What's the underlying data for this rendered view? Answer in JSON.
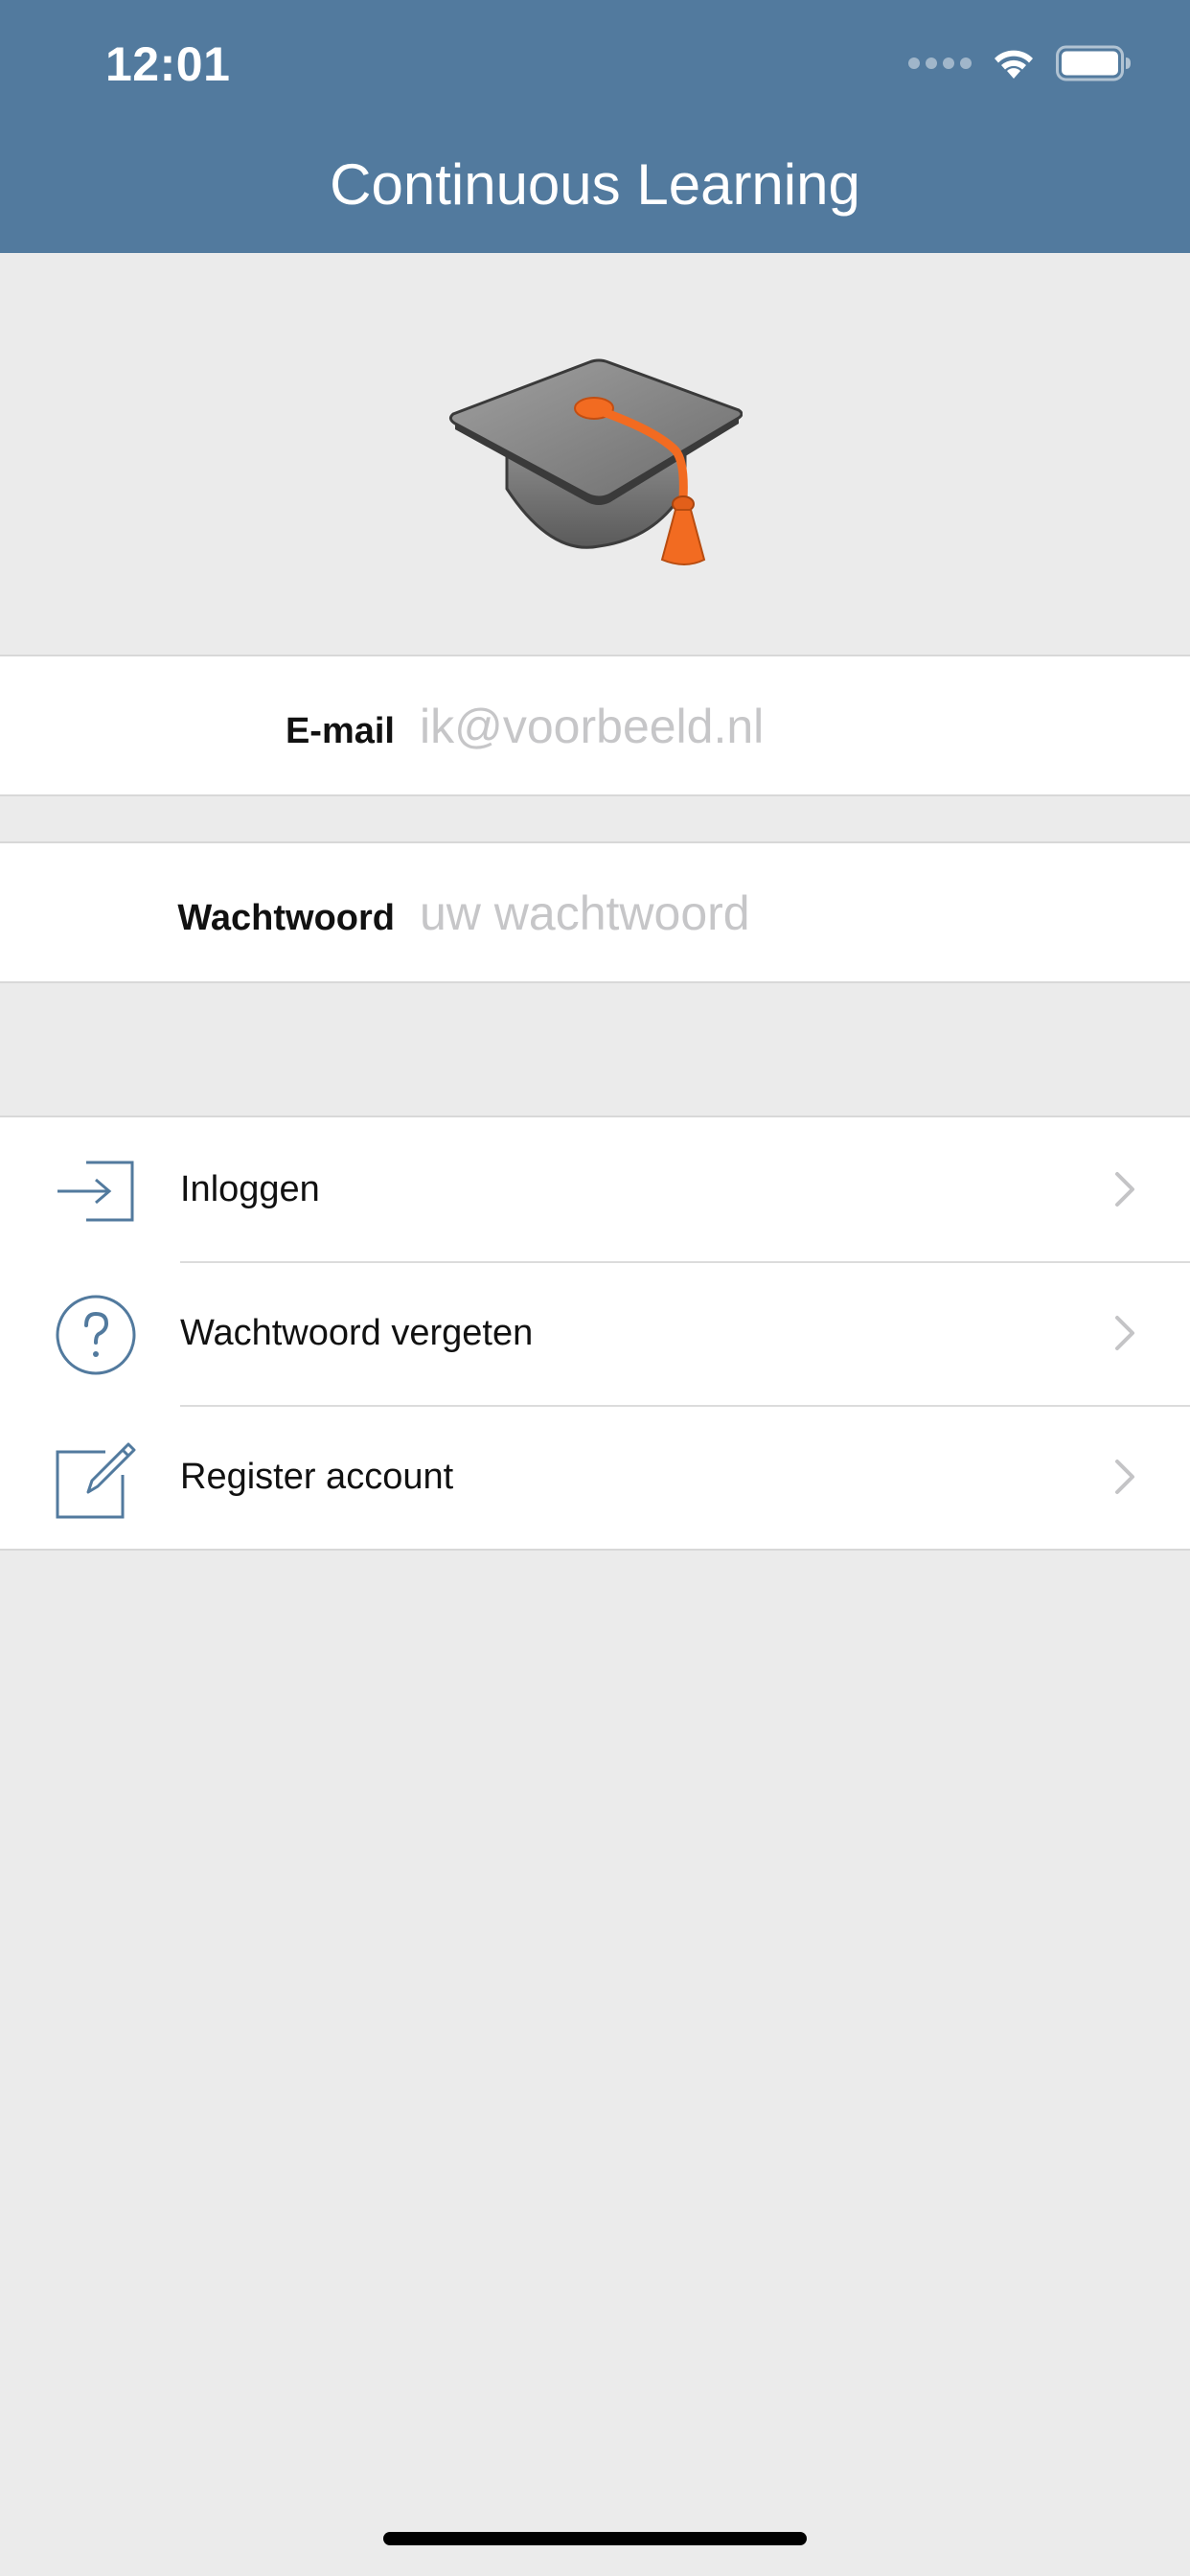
{
  "status_bar": {
    "time": "12:01"
  },
  "header": {
    "title": "Continuous Learning"
  },
  "logo": {
    "icon": "graduation-cap-icon"
  },
  "form": {
    "email": {
      "label": "E-mail",
      "placeholder": "ik@voorbeeld.nl",
      "value": ""
    },
    "password": {
      "label": "Wachtwoord",
      "placeholder": "uw wachtwoord",
      "value": ""
    }
  },
  "actions": [
    {
      "label": "Inloggen",
      "icon": "sign-in-icon"
    },
    {
      "label": "Wachtwoord vergeten",
      "icon": "question-circle-icon"
    },
    {
      "label": "Register account",
      "icon": "edit-icon"
    }
  ],
  "colors": {
    "header_bg": "#527a9e",
    "accent": "#527a9e",
    "page_bg": "#ebebeb",
    "cap_orange": "#f26b21"
  }
}
